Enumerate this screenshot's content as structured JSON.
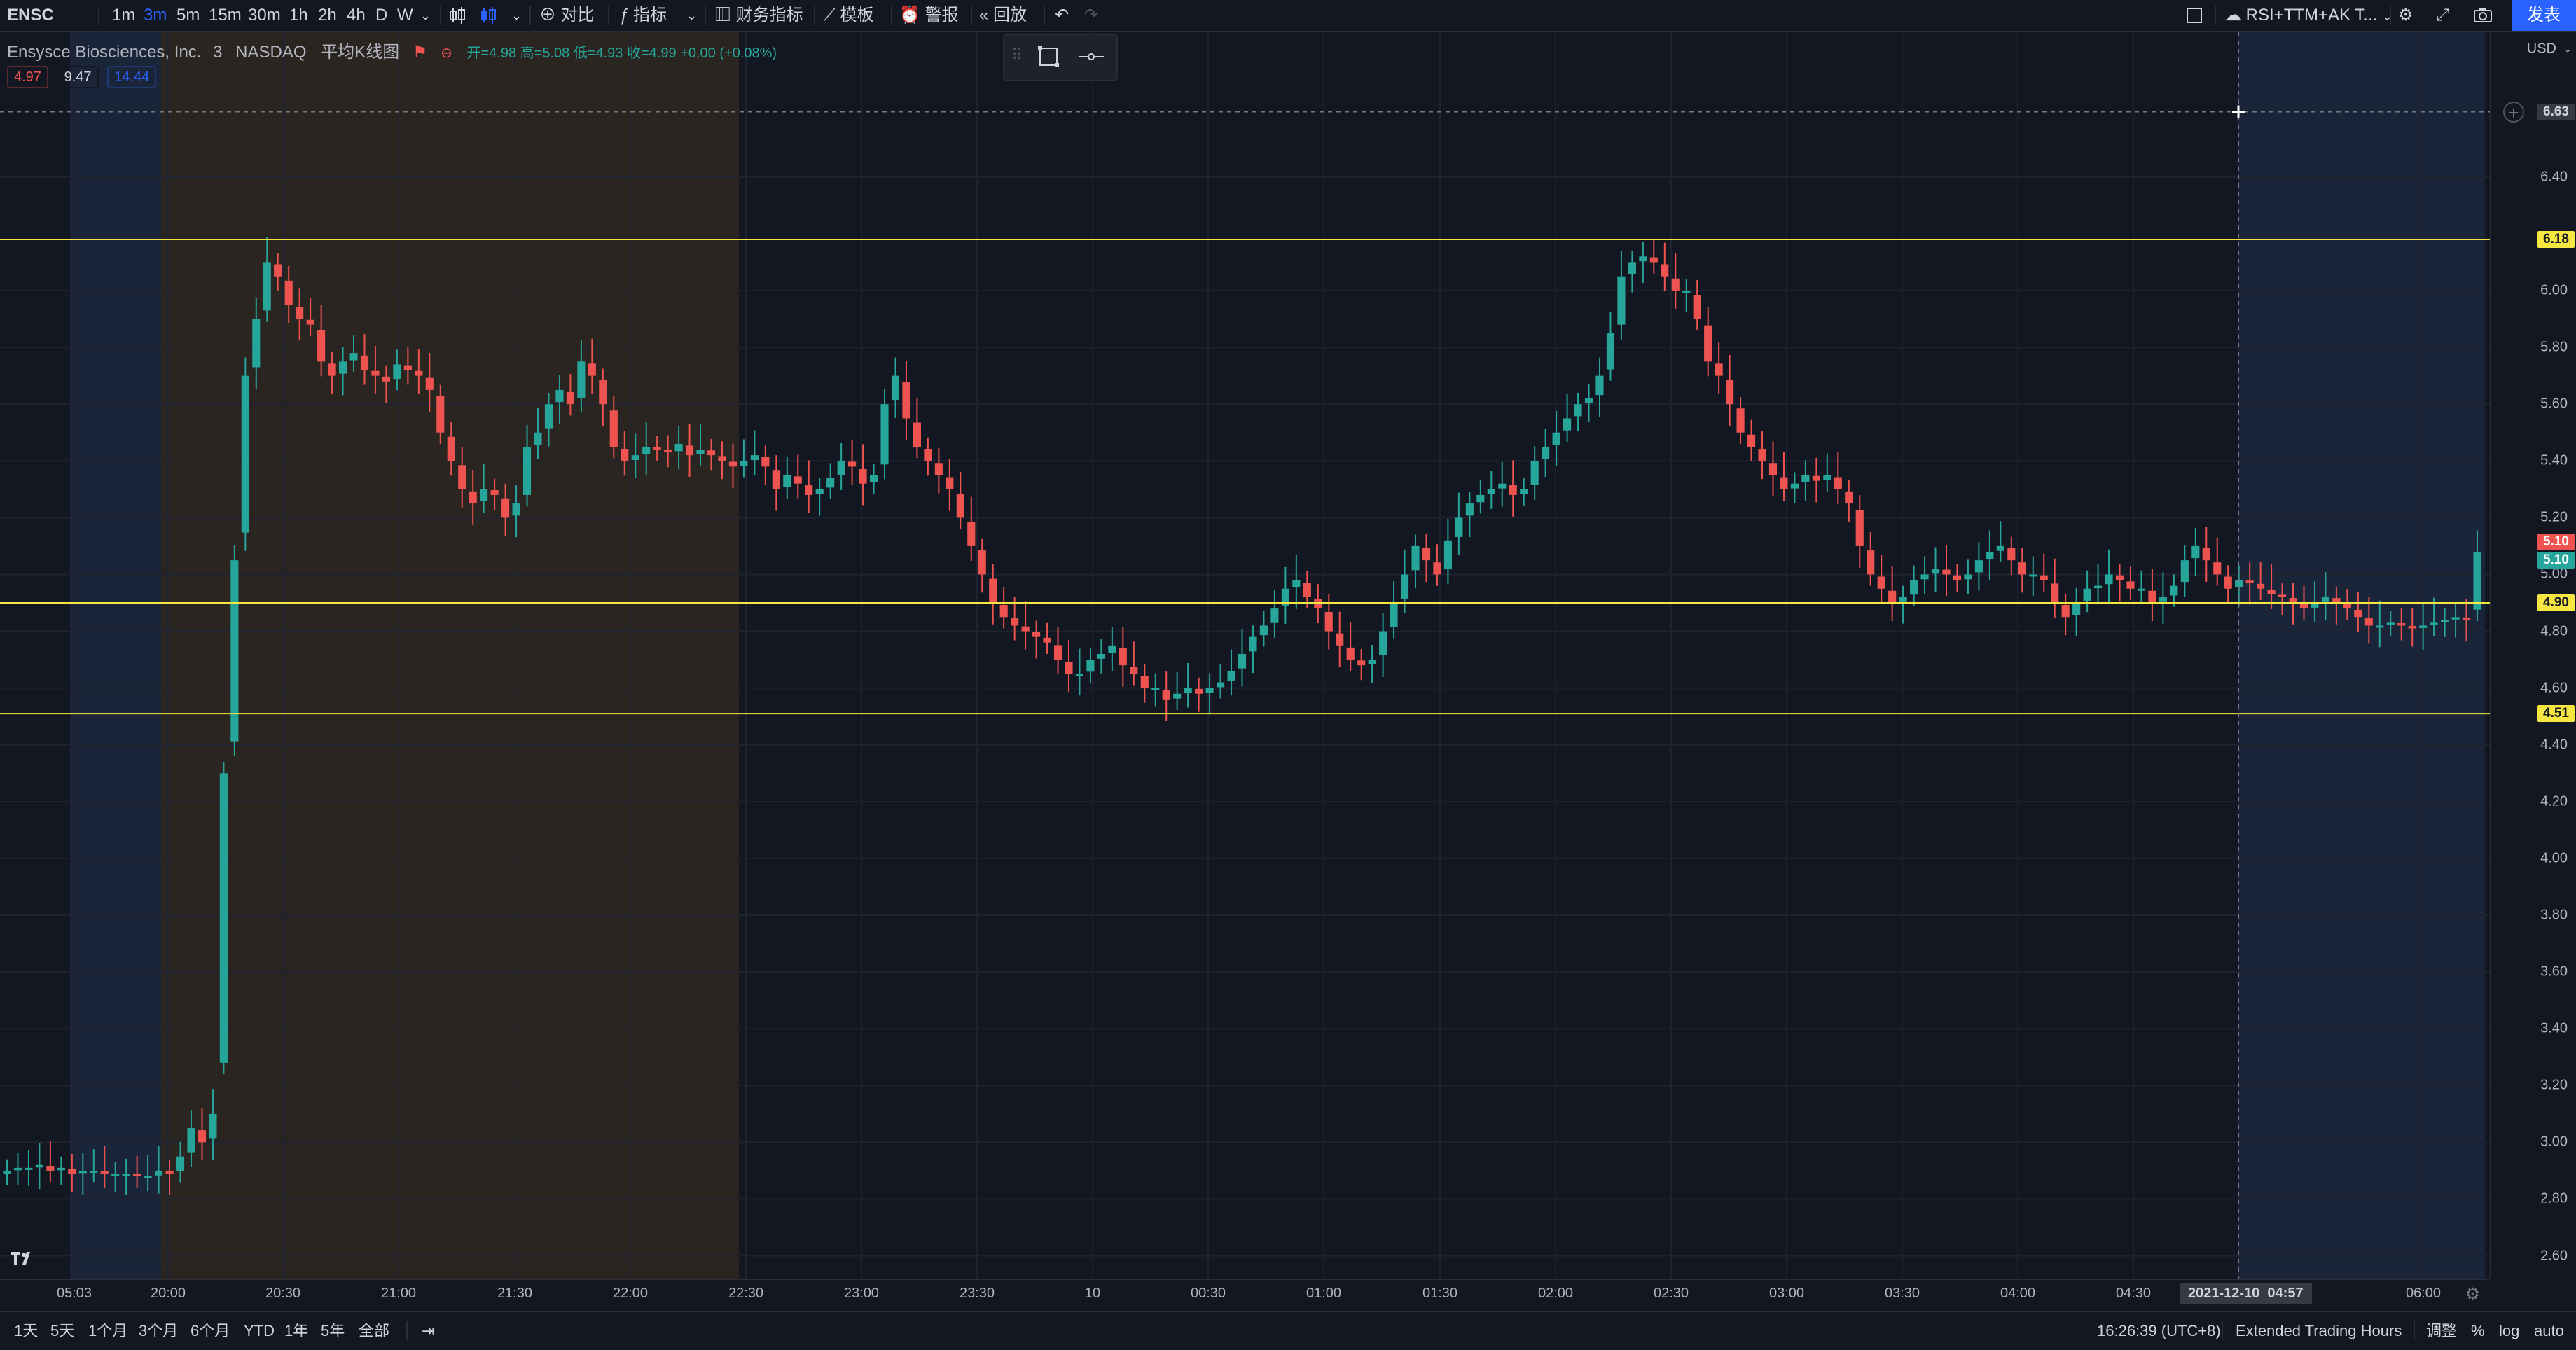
{
  "toolbar": {
    "symbol": "ENSC",
    "intervals": [
      "1m",
      "3m",
      "5m",
      "15m",
      "30m",
      "1h",
      "2h",
      "4h",
      "D",
      "W"
    ],
    "active_interval": "3m",
    "compare_label": "对比",
    "indicators_label": "指标",
    "financials_label": "财务指标",
    "templates_label": "模板",
    "alert_label": "警报",
    "replay_label": "回放",
    "layout_name": "RSI+TTM+AK T...",
    "publish_label": "发表"
  },
  "legend": {
    "name": "Ensysce Biosciences, Inc.",
    "interval": "3",
    "exchange": "NASDAQ",
    "chart_style": "平均K线图",
    "ohlc": "开=4.98 高=5.08 低=4.93 收=4.99 +0.00 (+0.08%)",
    "bid": "4.97",
    "spread": "9.47",
    "ask": "14.44"
  },
  "price_axis": {
    "currency": "USD",
    "ticks": [
      "6.40",
      "6.00",
      "5.80",
      "5.60",
      "5.40",
      "5.20",
      "5.00",
      "4.80",
      "4.60",
      "4.40",
      "4.20",
      "4.00",
      "3.80",
      "3.60",
      "3.40",
      "3.20",
      "3.00",
      "2.80",
      "2.60"
    ],
    "crosshair_label": "6.63",
    "badges": [
      {
        "label": "6.18",
        "value": 6.18,
        "bg": "#f5e642",
        "fg": "#131722"
      },
      {
        "label": "5.10",
        "value": 5.115,
        "bg": "#ef5350",
        "fg": "#ffffff"
      },
      {
        "label": "5.10",
        "value": 5.05,
        "bg": "#26a69a",
        "fg": "#ffffff"
      },
      {
        "label": "4.90",
        "value": 4.9,
        "bg": "#f5e642",
        "fg": "#131722"
      },
      {
        "label": "4.51",
        "value": 4.51,
        "bg": "#f5e642",
        "fg": "#131722"
      }
    ]
  },
  "time_axis": {
    "ticks": [
      "05:03",
      "20:00",
      "20:30",
      "21:00",
      "21:30",
      "22:00",
      "22:30",
      "23:00",
      "23:30",
      "10",
      "00:30",
      "01:00",
      "01:30",
      "02:00",
      "02:30",
      "03:00",
      "03:30",
      "04:00",
      "04:30",
      "06:00"
    ],
    "crosshair_label": "2021-12-10  04:57"
  },
  "bottom": {
    "ranges": [
      "1天",
      "5天",
      "1个月",
      "3个月",
      "6个月",
      "YTD",
      "1年",
      "5年",
      "全部"
    ],
    "clock": "16:26:39 (UTC+8)",
    "session": "Extended Trading Hours",
    "adjust": "调整",
    "percent": "%",
    "log": "log",
    "auto": "auto"
  },
  "chart_data": {
    "type": "candlestick",
    "symbol": "ENSC",
    "ylim": [
      2.52,
      6.91
    ],
    "horizontal_lines": [
      6.18,
      4.9,
      4.51
    ],
    "crosshair_price": 6.63,
    "colors": {
      "up": "#26a69a",
      "down": "#ef5350",
      "hline": "#f5e642",
      "premarket": "#1b2539",
      "postmarket": "#2a2520"
    },
    "closes": [
      2.9,
      2.91,
      2.91,
      2.92,
      2.9,
      2.91,
      2.89,
      2.9,
      2.9,
      2.89,
      2.89,
      2.89,
      2.88,
      2.88,
      2.9,
      2.89,
      2.95,
      3.05,
      3.0,
      3.1,
      4.3,
      5.05,
      5.7,
      5.9,
      6.1,
      6.05,
      5.95,
      5.9,
      5.88,
      5.75,
      5.7,
      5.75,
      5.78,
      5.72,
      5.7,
      5.68,
      5.74,
      5.72,
      5.7,
      5.65,
      5.5,
      5.4,
      5.3,
      5.25,
      5.3,
      5.28,
      5.2,
      5.25,
      5.45,
      5.5,
      5.6,
      5.65,
      5.6,
      5.75,
      5.7,
      5.6,
      5.45,
      5.4,
      5.42,
      5.45,
      5.44,
      5.43,
      5.46,
      5.42,
      5.44,
      5.42,
      5.4,
      5.38,
      5.4,
      5.42,
      5.38,
      5.3,
      5.35,
      5.32,
      5.28,
      5.3,
      5.34,
      5.4,
      5.38,
      5.32,
      5.35,
      5.6,
      5.7,
      5.55,
      5.45,
      5.4,
      5.35,
      5.3,
      5.2,
      5.1,
      5.0,
      4.9,
      4.85,
      4.82,
      4.8,
      4.78,
      4.76,
      4.7,
      4.65,
      4.65,
      4.7,
      4.72,
      4.75,
      4.68,
      4.65,
      4.6,
      4.6,
      4.56,
      4.58,
      4.6,
      4.58,
      4.6,
      4.62,
      4.66,
      4.72,
      4.78,
      4.82,
      4.88,
      4.95,
      4.98,
      4.92,
      4.88,
      4.8,
      4.75,
      4.7,
      4.68,
      4.7,
      4.8,
      4.9,
      5.0,
      5.1,
      5.05,
      5.0,
      5.12,
      5.2,
      5.25,
      5.28,
      5.3,
      5.32,
      5.28,
      5.3,
      5.4,
      5.45,
      5.5,
      5.55,
      5.6,
      5.62,
      5.7,
      5.85,
      6.05,
      6.1,
      6.12,
      6.1,
      6.05,
      6.0,
      6.0,
      5.9,
      5.75,
      5.7,
      5.6,
      5.5,
      5.45,
      5.4,
      5.35,
      5.3,
      5.32,
      5.35,
      5.33,
      5.35,
      5.3,
      5.25,
      5.1,
      5.0,
      4.95,
      4.9,
      4.92,
      4.98,
      5.0,
      5.02,
      5.0,
      4.98,
      5.0,
      5.05,
      5.08,
      5.1,
      5.05,
      5.0,
      5.0,
      4.98,
      4.9,
      4.85,
      4.9,
      4.95,
      4.96,
      5.0,
      4.98,
      4.95,
      4.95,
      4.9,
      4.92,
      4.96,
      5.05,
      5.1,
      5.05,
      5.0,
      4.95,
      4.98,
      4.97,
      4.95,
      4.93,
      4.92,
      4.9,
      4.88,
      4.9,
      4.92,
      4.9,
      4.88,
      4.85,
      4.82,
      4.82,
      4.83,
      4.82,
      4.81,
      4.82,
      4.83,
      4.84,
      4.85,
      4.84,
      5.08
    ]
  }
}
